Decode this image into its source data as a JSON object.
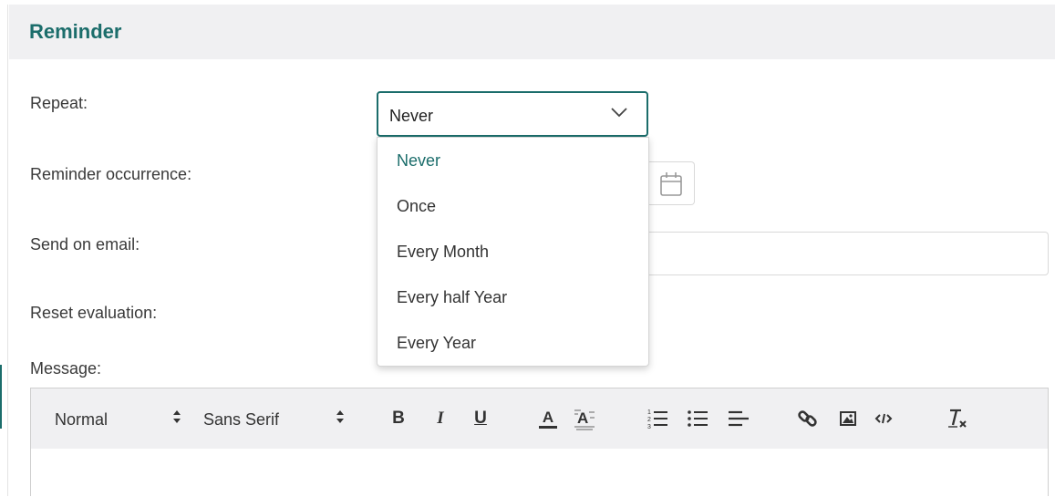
{
  "panel": {
    "title": "Reminder"
  },
  "form": {
    "repeat_label": "Repeat:",
    "occurrence_label": "Reminder occurrence:",
    "email_label": "Send on email:",
    "reset_label": "Reset evaluation:",
    "message_label": "Message:"
  },
  "repeat_select": {
    "value": "Never",
    "options": [
      {
        "label": "Never",
        "selected": true
      },
      {
        "label": "Once",
        "selected": false
      },
      {
        "label": "Every Month",
        "selected": false
      },
      {
        "label": "Every half Year",
        "selected": false
      },
      {
        "label": "Every Year",
        "selected": false
      }
    ]
  },
  "toolbar": {
    "size_value": "Normal",
    "font_value": "Sans Serif",
    "bold": "B",
    "italic": "I",
    "underline": "U",
    "text_color": "A",
    "buttons": [
      "bold-icon",
      "italic-icon",
      "underline-icon",
      "text-color-icon",
      "background-color-icon",
      "ordered-list-icon",
      "bullet-list-icon",
      "align-left-icon",
      "link-icon",
      "image-icon",
      "code-icon",
      "clear-format-icon"
    ]
  },
  "colors": {
    "accent": "#1b6d6b",
    "header_bg": "#f0f0f2",
    "border": "#d9d9d9"
  }
}
